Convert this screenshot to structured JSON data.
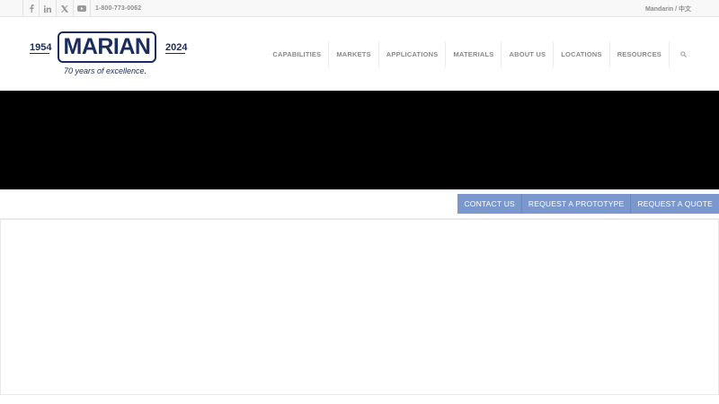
{
  "topbar": {
    "social": [
      {
        "icon": "facebook-icon",
        "glyph": "f"
      },
      {
        "icon": "linkedin-icon",
        "glyph": "in"
      },
      {
        "icon": "x-twitter-icon",
        "glyph": "𝕏"
      },
      {
        "icon": "youtube-icon",
        "glyph": "▶"
      }
    ],
    "phone": "1-800-773-0062",
    "language": "Mandarin / 中文"
  },
  "logo": {
    "year_start": "1954",
    "name": "MARIAN",
    "year_end": "2024",
    "tagline": "70 years of excellence.",
    "brand_color": "#1b2d5e"
  },
  "nav": {
    "items": [
      "CAPABILITIES",
      "MARKETS",
      "APPLICATIONS",
      "MATERIALS",
      "ABOUT US",
      "LOCATIONS",
      "RESOURCES"
    ],
    "search_icon": "search-icon"
  },
  "cta": {
    "contact": "CONTACT US",
    "prototype": "REQUEST A PROTOTYPE",
    "quote": "REQUEST A QUOTE",
    "button_color": "#7a98cd"
  }
}
